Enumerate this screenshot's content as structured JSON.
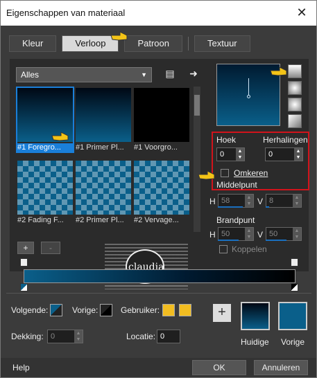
{
  "window": {
    "title": "Eigenschappen van materiaal",
    "close": "✕"
  },
  "tabs": [
    {
      "label": "Kleur"
    },
    {
      "label": "Verloop"
    },
    {
      "label": "Patroon"
    },
    {
      "label": "Textuur"
    }
  ],
  "library": {
    "category": "Alles",
    "items": [
      {
        "label": "#1 Foregro..."
      },
      {
        "label": "#1 Primer Pl..."
      },
      {
        "label": "#1 Voorgro..."
      },
      {
        "label": "#2 Fading F..."
      },
      {
        "label": "#2 Primer Pl..."
      },
      {
        "label": "#2 Vervage..."
      }
    ]
  },
  "angle": {
    "label": "Hoek",
    "value": "0"
  },
  "repeats": {
    "label": "Herhalingen",
    "value": "0"
  },
  "invert": {
    "label": "Omkeren"
  },
  "center": {
    "label": "Middelpunt",
    "h_label": "H",
    "h_value": "58",
    "v_label": "V",
    "v_value": "8"
  },
  "focal": {
    "label": "Brandpunt",
    "h_label": "H",
    "h_value": "50",
    "v_label": "V",
    "v_value": "50",
    "link_label": "Koppelen"
  },
  "stops": {
    "add": "+",
    "remove": "-"
  },
  "bottom": {
    "next_label": "Volgende:",
    "prev_label": "Vorige:",
    "user_label": "Gebruiker:",
    "opacity_label": "Dekking:",
    "opacity_value": "0",
    "location_label": "Locatie:",
    "location_value": "0",
    "current_label": "Huidige",
    "previous_label": "Vorige"
  },
  "footer": {
    "help": "Help",
    "ok": "OK",
    "cancel": "Annuleren"
  },
  "watermark": {
    "text": "claudia"
  },
  "colors": {
    "dark_blue": "#001a30",
    "mid_blue": "#0a5f8a",
    "accent": "#1a7fd9",
    "highlight_red": "#d2131b",
    "user_yellow": "#f2bd21"
  }
}
